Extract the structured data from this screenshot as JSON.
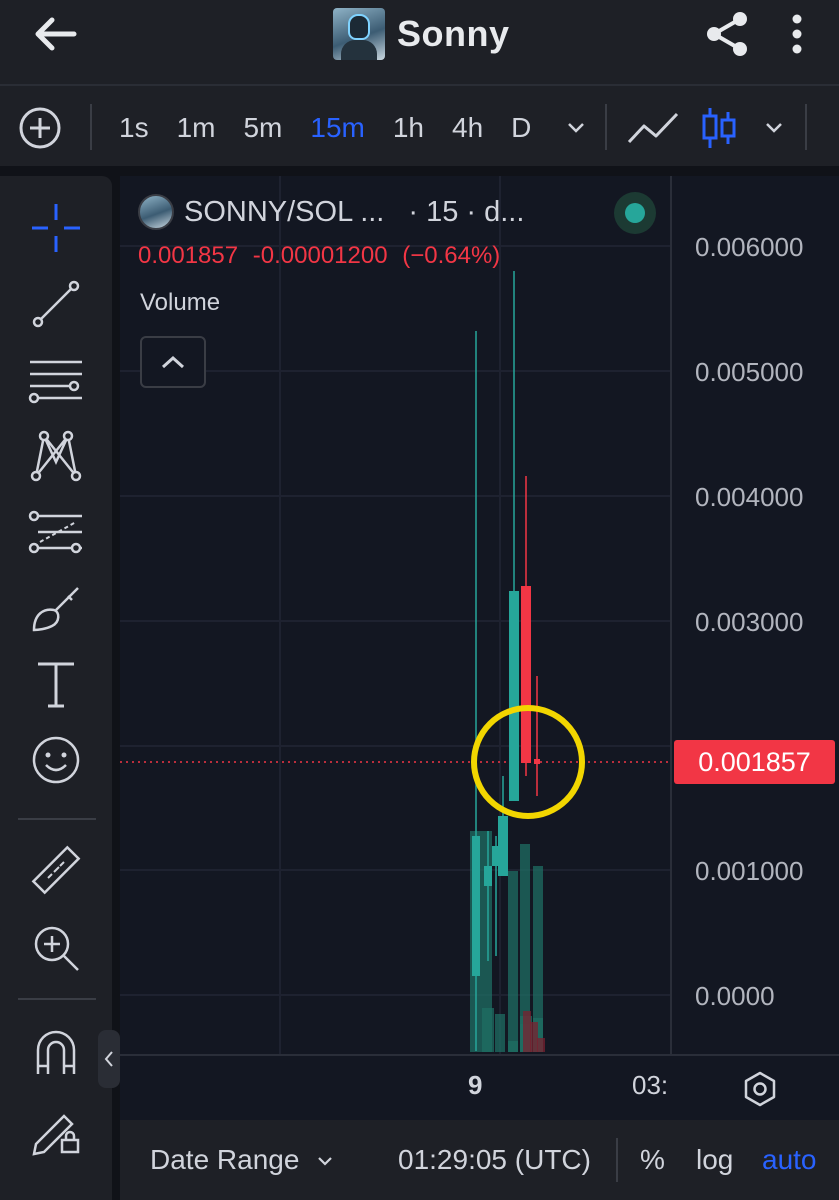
{
  "appbar": {
    "title": "Sonny"
  },
  "toolbar": {
    "intervals": [
      {
        "label": "1s",
        "active": false
      },
      {
        "label": "1m",
        "active": false
      },
      {
        "label": "5m",
        "active": false
      },
      {
        "label": "15m",
        "active": true
      },
      {
        "label": "1h",
        "active": false
      },
      {
        "label": "4h",
        "active": false
      },
      {
        "label": "D",
        "active": false
      }
    ]
  },
  "legend": {
    "symbol": "SONNY/SOL ...",
    "timeframe": "· 15 · d...",
    "last_price": "0.001857",
    "change_abs": "-0.00001200",
    "change_pct": "(−0.64%)",
    "volume_label": "Volume"
  },
  "price_axis": {
    "labels": [
      "0.006000",
      "0.005000",
      "0.004000",
      "0.003000",
      "0.001000",
      "0.0000"
    ],
    "current_price": "0.001857"
  },
  "time_axis": {
    "labels": [
      "9",
      "03:"
    ]
  },
  "bottombar": {
    "date_range": "Date Range",
    "time": "01:29:05 (UTC)",
    "percent": "%",
    "log": "log",
    "auto": "auto"
  },
  "colors": {
    "up": "#26a69a",
    "down": "#f23645",
    "accent": "#2962ff",
    "highlight": "#f2d600"
  }
}
